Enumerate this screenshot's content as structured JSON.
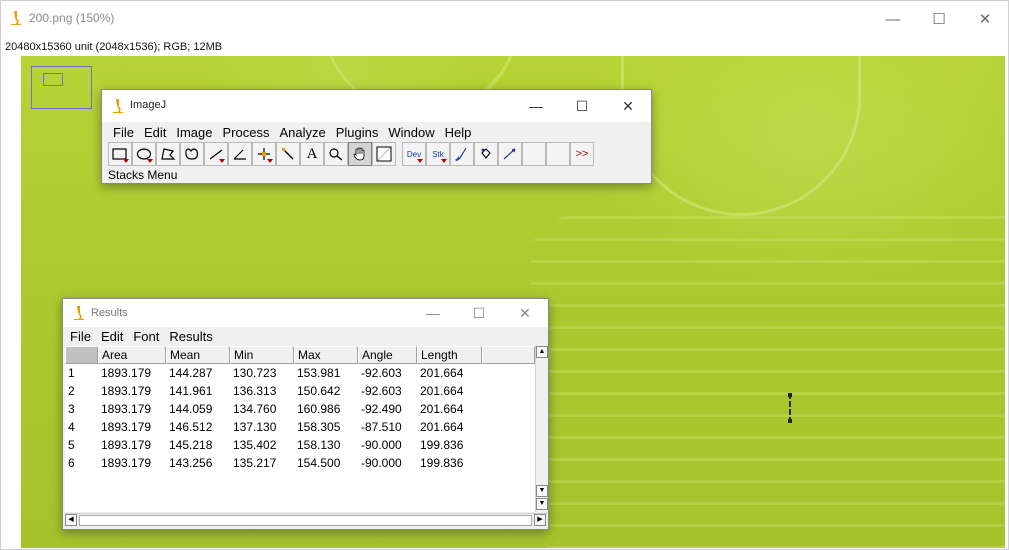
{
  "main_window": {
    "title": "200.png (150%)",
    "info": "20480x15360 unit (2048x1536); RGB; 12MB",
    "controls": {
      "minimize": "—",
      "maximize": "☐",
      "close": "✕"
    }
  },
  "imagej": {
    "title": "ImageJ",
    "menu": [
      "File",
      "Edit",
      "Image",
      "Process",
      "Analyze",
      "Plugins",
      "Window",
      "Help"
    ],
    "tools": [
      {
        "name": "rectangle-tool-icon"
      },
      {
        "name": "oval-tool-icon"
      },
      {
        "name": "polygon-tool-icon"
      },
      {
        "name": "freehand-tool-icon"
      },
      {
        "name": "line-tool-icon"
      },
      {
        "name": "angle-tool-icon"
      },
      {
        "name": "point-tool-icon"
      },
      {
        "name": "wand-tool-icon"
      },
      {
        "name": "text-tool-icon",
        "glyph": "A"
      },
      {
        "name": "magnifier-icon"
      },
      {
        "name": "hand-icon",
        "selected": true
      },
      {
        "name": "color-picker-icon"
      },
      {
        "name": "dev-menu",
        "glyph": "Dev"
      },
      {
        "name": "stk-menu",
        "glyph": "Stk"
      },
      {
        "name": "brush-icon"
      },
      {
        "name": "flood-fill-icon"
      },
      {
        "name": "arrow-pen-icon"
      },
      {
        "name": "empty-slot-1"
      },
      {
        "name": "empty-slot-2"
      },
      {
        "name": "more-tools-icon",
        "glyph": ">>"
      }
    ],
    "status": "Stacks Menu",
    "controls": {
      "minimize": "—",
      "maximize": "☐",
      "close": "✕"
    }
  },
  "results": {
    "title": "Results",
    "menu": [
      "File",
      "Edit",
      "Font",
      "Results"
    ],
    "columns": [
      "",
      "Area",
      "Mean",
      "Min",
      "Max",
      "Angle",
      "Length"
    ],
    "rows": [
      [
        "1",
        "1893.179",
        "144.287",
        "130.723",
        "153.981",
        "-92.603",
        "201.664"
      ],
      [
        "2",
        "1893.179",
        "141.961",
        "136.313",
        "150.642",
        "-92.603",
        "201.664"
      ],
      [
        "3",
        "1893.179",
        "144.059",
        "134.760",
        "160.986",
        "-92.490",
        "201.664"
      ],
      [
        "4",
        "1893.179",
        "146.512",
        "137.130",
        "158.305",
        "-87.510",
        "201.664"
      ],
      [
        "5",
        "1893.179",
        "145.218",
        "135.402",
        "158.130",
        "-90.000",
        "199.836"
      ],
      [
        "6",
        "1893.179",
        "143.256",
        "135.217",
        "154.500",
        "-90.000",
        "199.836"
      ]
    ],
    "controls": {
      "minimize": "—",
      "maximize": "☐",
      "close": "✕"
    }
  },
  "colors": {
    "image_green": "#acc930",
    "icon_orange": "#e8a000",
    "selection_blue": "#7070d0"
  }
}
